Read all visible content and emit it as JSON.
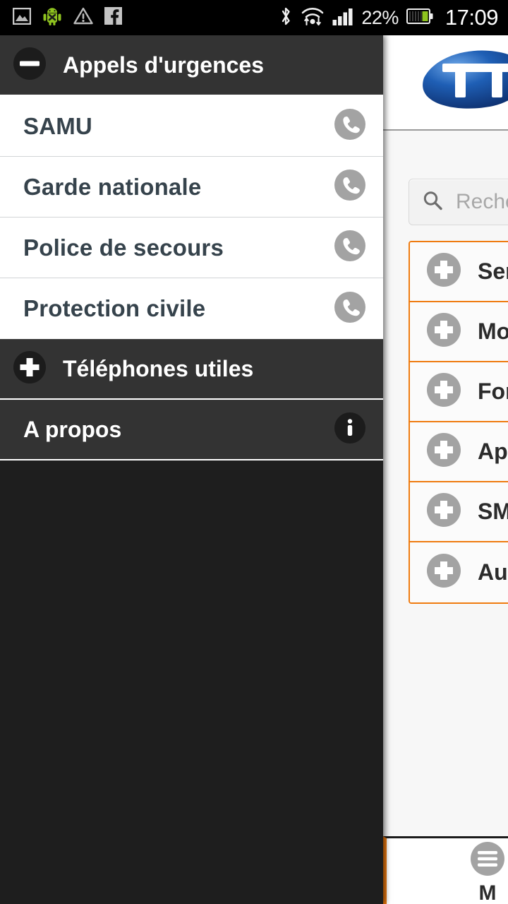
{
  "statusbar": {
    "left_icons": [
      "image-icon",
      "android-debug-icon",
      "warning-icon",
      "facebook-icon"
    ],
    "right_icons": [
      "bluetooth-icon",
      "wifi-transfer-icon",
      "signal-bars-icon",
      "battery-icon"
    ],
    "battery_percent": "22%",
    "clock": "17:09"
  },
  "drawer": {
    "header": {
      "title": "Appels d'urgences",
      "toggle_icon": "minus-circle-icon"
    },
    "emergency_items": [
      {
        "label": "SAMU",
        "action_icon": "phone-icon"
      },
      {
        "label": "Garde nationale",
        "action_icon": "phone-icon"
      },
      {
        "label": "Police de secours",
        "action_icon": "phone-icon"
      },
      {
        "label": "Protection civile",
        "action_icon": "phone-icon"
      }
    ],
    "sections": [
      {
        "label": "Téléphones utiles",
        "left_icon": "plus-circle-icon",
        "right_icon": ""
      },
      {
        "label": "A propos",
        "left_icon": "",
        "right_icon": "info-circle-icon"
      }
    ]
  },
  "content": {
    "brand": {
      "logo_alt": "TT",
      "logo_icon": "tt-logo"
    },
    "search": {
      "placeholder": "Reche",
      "icon": "search-icon"
    },
    "categories": [
      {
        "label": "Serv",
        "icon": "plus-circle-icon"
      },
      {
        "label": "Mon",
        "icon": "plus-circle-icon"
      },
      {
        "label": "Forf",
        "icon": "plus-circle-icon"
      },
      {
        "label": "App",
        "icon": "plus-circle-icon"
      },
      {
        "label": "SMS",
        "icon": "plus-circle-icon"
      },
      {
        "label": "Autr",
        "icon": "plus-circle-icon"
      }
    ],
    "bottom_bar": {
      "label": "M",
      "icon": "menu-circle-icon"
    }
  },
  "colors": {
    "accent_orange": "#ef7b10",
    "drawer_dark": "#1e1e1e",
    "drawer_section": "#333333",
    "list_text": "#36434c",
    "icon_gray": "#a0a0a0"
  }
}
